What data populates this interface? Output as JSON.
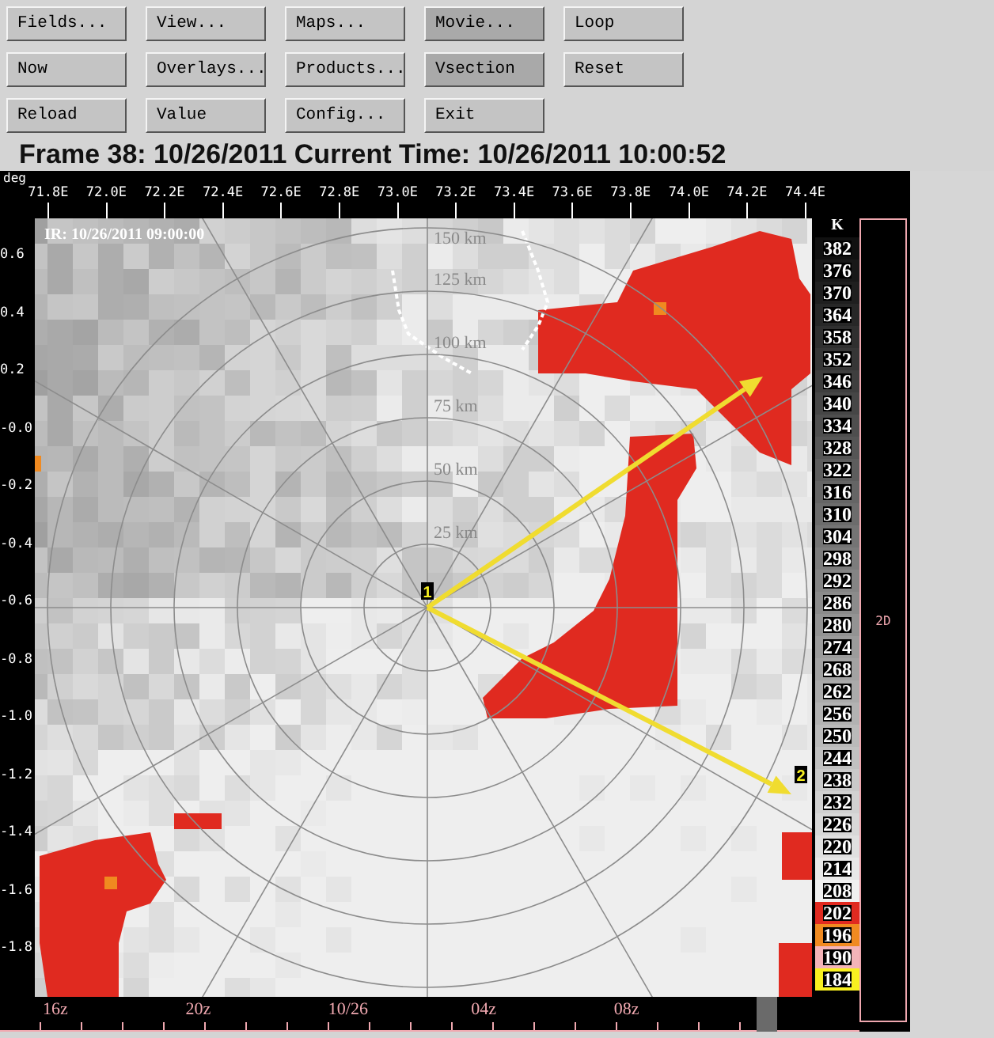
{
  "toolbar": {
    "buttons": [
      {
        "label": "Fields...",
        "selected": false
      },
      {
        "label": "View...",
        "selected": false
      },
      {
        "label": "Maps...",
        "selected": false
      },
      {
        "label": "Movie...",
        "selected": true
      },
      {
        "label": "Loop",
        "selected": false
      },
      {
        "label": "Now",
        "selected": false
      },
      {
        "label": "Overlays...",
        "selected": false
      },
      {
        "label": "Products...",
        "selected": false
      },
      {
        "label": "Vsection",
        "selected": true
      },
      {
        "label": "Reset",
        "selected": false
      },
      {
        "label": "Reload",
        "selected": false
      },
      {
        "label": "Value",
        "selected": false
      },
      {
        "label": "Config...",
        "selected": false
      },
      {
        "label": "Exit",
        "selected": false
      }
    ]
  },
  "frame_title": "Frame 38: 10/26/2011 Current Time: 10/26/2011 10:00:52",
  "plot": {
    "unit_label": "deg",
    "x_labels": [
      "71.8E",
      "72.0E",
      "72.2E",
      "72.4E",
      "72.6E",
      "72.8E",
      "73.0E",
      "73.2E",
      "73.4E",
      "73.6E",
      "73.8E",
      "74.0E",
      "74.2E",
      "74.4E"
    ],
    "y_labels": [
      "0.6",
      "0.4",
      "0.2",
      "-0.0",
      "-0.2",
      "-0.4",
      "-0.6",
      "-0.8",
      "-1.0",
      "-1.2",
      "-1.4",
      "-1.6",
      "-1.8"
    ],
    "image_label": "IR: 10/26/2011 09:00:00",
    "range_rings": [
      "150 km",
      "125 km",
      "100 km",
      "75 km",
      "50 km",
      "25 km"
    ],
    "markers": [
      "1",
      "2"
    ]
  },
  "color_scale": {
    "unit": "K",
    "entries": [
      {
        "value": "382",
        "color": "#101010"
      },
      {
        "value": "376",
        "color": "#181818"
      },
      {
        "value": "370",
        "color": "#1f1f1f"
      },
      {
        "value": "364",
        "color": "#272727"
      },
      {
        "value": "358",
        "color": "#2f2f2f"
      },
      {
        "value": "352",
        "color": "#363636"
      },
      {
        "value": "346",
        "color": "#3e3e3e"
      },
      {
        "value": "340",
        "color": "#464646"
      },
      {
        "value": "334",
        "color": "#4e4e4e"
      },
      {
        "value": "328",
        "color": "#555555"
      },
      {
        "value": "322",
        "color": "#5d5d5d"
      },
      {
        "value": "316",
        "color": "#656565"
      },
      {
        "value": "310",
        "color": "#6c6c6c"
      },
      {
        "value": "304",
        "color": "#747474"
      },
      {
        "value": "298",
        "color": "#7c7c7c"
      },
      {
        "value": "292",
        "color": "#848484"
      },
      {
        "value": "286",
        "color": "#8b8b8b"
      },
      {
        "value": "280",
        "color": "#939393"
      },
      {
        "value": "274",
        "color": "#9b9b9b"
      },
      {
        "value": "268",
        "color": "#a2a2a2"
      },
      {
        "value": "262",
        "color": "#aaaaaa"
      },
      {
        "value": "256",
        "color": "#b2b2b2"
      },
      {
        "value": "250",
        "color": "#bababa"
      },
      {
        "value": "244",
        "color": "#c1c1c1"
      },
      {
        "value": "238",
        "color": "#c9c9c9"
      },
      {
        "value": "232",
        "color": "#d1d1d1"
      },
      {
        "value": "226",
        "color": "#d8d8d8"
      },
      {
        "value": "220",
        "color": "#e0e0e0"
      },
      {
        "value": "214",
        "color": "#e8e8e8"
      },
      {
        "value": "208",
        "color": "#f0f0f0"
      },
      {
        "value": "202",
        "color": "#e02a20"
      },
      {
        "value": "196",
        "color": "#f08a20"
      },
      {
        "value": "190",
        "color": "#f4b4b8"
      },
      {
        "value": "184",
        "color": "#f8f020"
      }
    ]
  },
  "side_panel": {
    "label": "2D"
  },
  "time_axis": {
    "labels": [
      "16z",
      "20z",
      "10/26",
      "04z",
      "08z"
    ]
  }
}
